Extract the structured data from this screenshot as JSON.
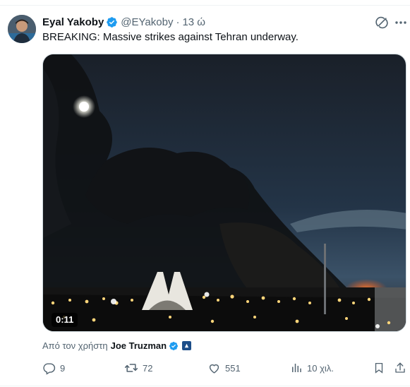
{
  "tweet": {
    "author_name": "Eyal Yakoby",
    "handle": "@EYakoby",
    "separator": "·",
    "time": "13 ώ",
    "text": "BREAKING: Massive strikes against Tehran underway."
  },
  "media": {
    "type": "video",
    "duration": "0:11"
  },
  "attribution": {
    "prefix": "Από τον χρήστη",
    "user": "Joe Truzman"
  },
  "actions": {
    "replies": "9",
    "reposts": "72",
    "likes": "551",
    "views": "10 χιλ."
  },
  "icons": [
    "verified-icon",
    "grok-icon",
    "more-icon",
    "reply-icon",
    "repost-icon",
    "like-icon",
    "views-icon",
    "bookmark-icon",
    "share-icon"
  ],
  "colors": {
    "verified": "#1d9bf0",
    "text_primary": "#0f1419",
    "text_secondary": "#536471",
    "border": "#cfd9de"
  }
}
